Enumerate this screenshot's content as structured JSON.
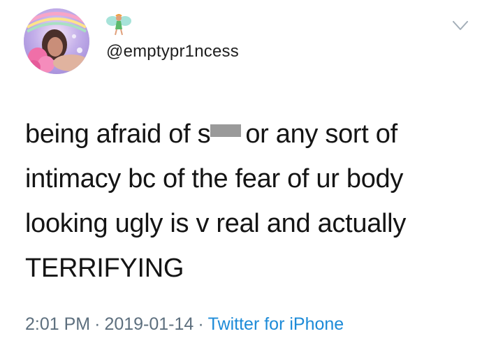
{
  "user": {
    "handle": "@emptypr1ncess",
    "avatar_icon": "profile-photo",
    "badge_icon": "fairy-emoji"
  },
  "tweet": {
    "lines": [
      "being afraid of s",
      "or any sort of",
      "intimacy bc of the fear of ur body",
      "looking ugly is v real and actually",
      "TERRIFYING"
    ],
    "redaction_icon": "censor-bar"
  },
  "meta": {
    "time": "2:01 PM",
    "separator": "·",
    "date": "2019-01-14",
    "source": "Twitter for iPhone"
  },
  "colors": {
    "text": "#141414",
    "meta": "#5d6f7e",
    "link": "#1d8bd8"
  }
}
